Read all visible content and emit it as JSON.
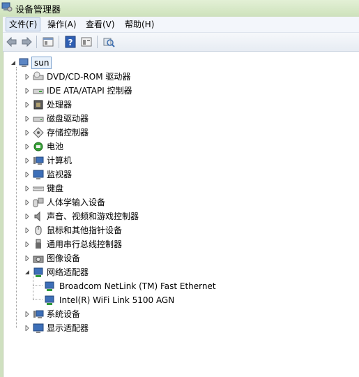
{
  "window": {
    "title": "设备管理器",
    "icon": "device-manager-icon"
  },
  "menu": [
    {
      "label": "文件(F)",
      "active": true
    },
    {
      "label": "操作(A)",
      "active": false
    },
    {
      "label": "查看(V)",
      "active": false
    },
    {
      "label": "帮助(H)",
      "active": false
    }
  ],
  "toolbar": {
    "buttons": [
      "back-arrow-icon",
      "forward-arrow-icon",
      "properties-icon",
      "help-icon",
      "view-icon",
      "scan-hardware-icon"
    ]
  },
  "tree": {
    "root": {
      "label": "sun",
      "icon": "computer-icon",
      "expanded": true
    },
    "categories": [
      {
        "label": "DVD/CD-ROM 驱动器",
        "icon": "dvd-drive-icon",
        "expanded": false
      },
      {
        "label": "IDE ATA/ATAPI 控制器",
        "icon": "ide-controller-icon",
        "expanded": false
      },
      {
        "label": "处理器",
        "icon": "processor-icon",
        "expanded": false
      },
      {
        "label": "磁盘驱动器",
        "icon": "disk-drive-icon",
        "expanded": false
      },
      {
        "label": "存储控制器",
        "icon": "storage-controller-icon",
        "expanded": false
      },
      {
        "label": "电池",
        "icon": "battery-icon",
        "expanded": false
      },
      {
        "label": "计算机",
        "icon": "computer-icon",
        "expanded": false
      },
      {
        "label": "监视器",
        "icon": "monitor-icon",
        "expanded": false
      },
      {
        "label": "键盘",
        "icon": "keyboard-icon",
        "expanded": false
      },
      {
        "label": "人体学输入设备",
        "icon": "hid-icon",
        "expanded": false
      },
      {
        "label": "声音、视频和游戏控制器",
        "icon": "sound-icon",
        "expanded": false
      },
      {
        "label": "鼠标和其他指针设备",
        "icon": "mouse-icon",
        "expanded": false
      },
      {
        "label": "通用串行总线控制器",
        "icon": "usb-icon",
        "expanded": false
      },
      {
        "label": "图像设备",
        "icon": "camera-icon",
        "expanded": false
      },
      {
        "label": "网络适配器",
        "icon": "network-adapter-icon",
        "expanded": true,
        "children": [
          {
            "label": "Broadcom NetLink (TM) Fast Ethernet",
            "icon": "network-adapter-icon"
          },
          {
            "label": "Intel(R) WiFi Link 5100 AGN",
            "icon": "network-adapter-icon"
          }
        ]
      },
      {
        "label": "系统设备",
        "icon": "system-device-icon",
        "expanded": false
      },
      {
        "label": "显示适配器",
        "icon": "display-adapter-icon",
        "expanded": false
      }
    ]
  }
}
